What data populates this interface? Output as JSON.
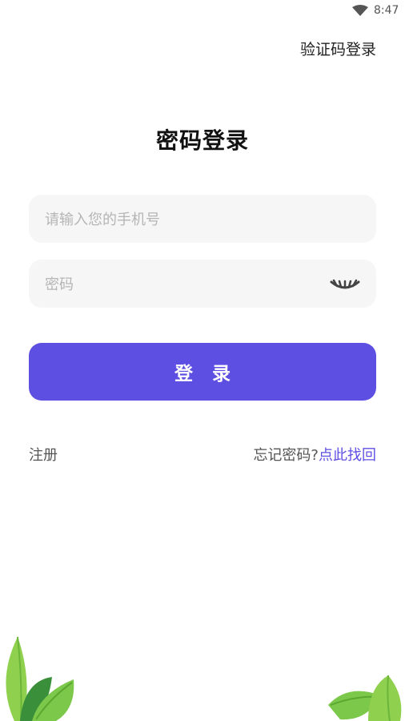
{
  "status_bar": {
    "time": "8:47",
    "icon": "wifi-icon"
  },
  "header": {
    "switch_link": "验证码登录"
  },
  "title": "密码登录",
  "phone_field": {
    "placeholder": "请输入您的手机号",
    "value": ""
  },
  "password_field": {
    "placeholder": "密码",
    "value": "",
    "toggle_icon": "eye-closed-icon"
  },
  "login_button": "登 录",
  "footer": {
    "register": "注册",
    "forgot_prefix": "忘记密码?",
    "recover_link": "点此找回"
  },
  "colors": {
    "accent": "#5e4fe3",
    "field_bg": "#f6f6f6",
    "leaf_green": "#7cc84a"
  }
}
